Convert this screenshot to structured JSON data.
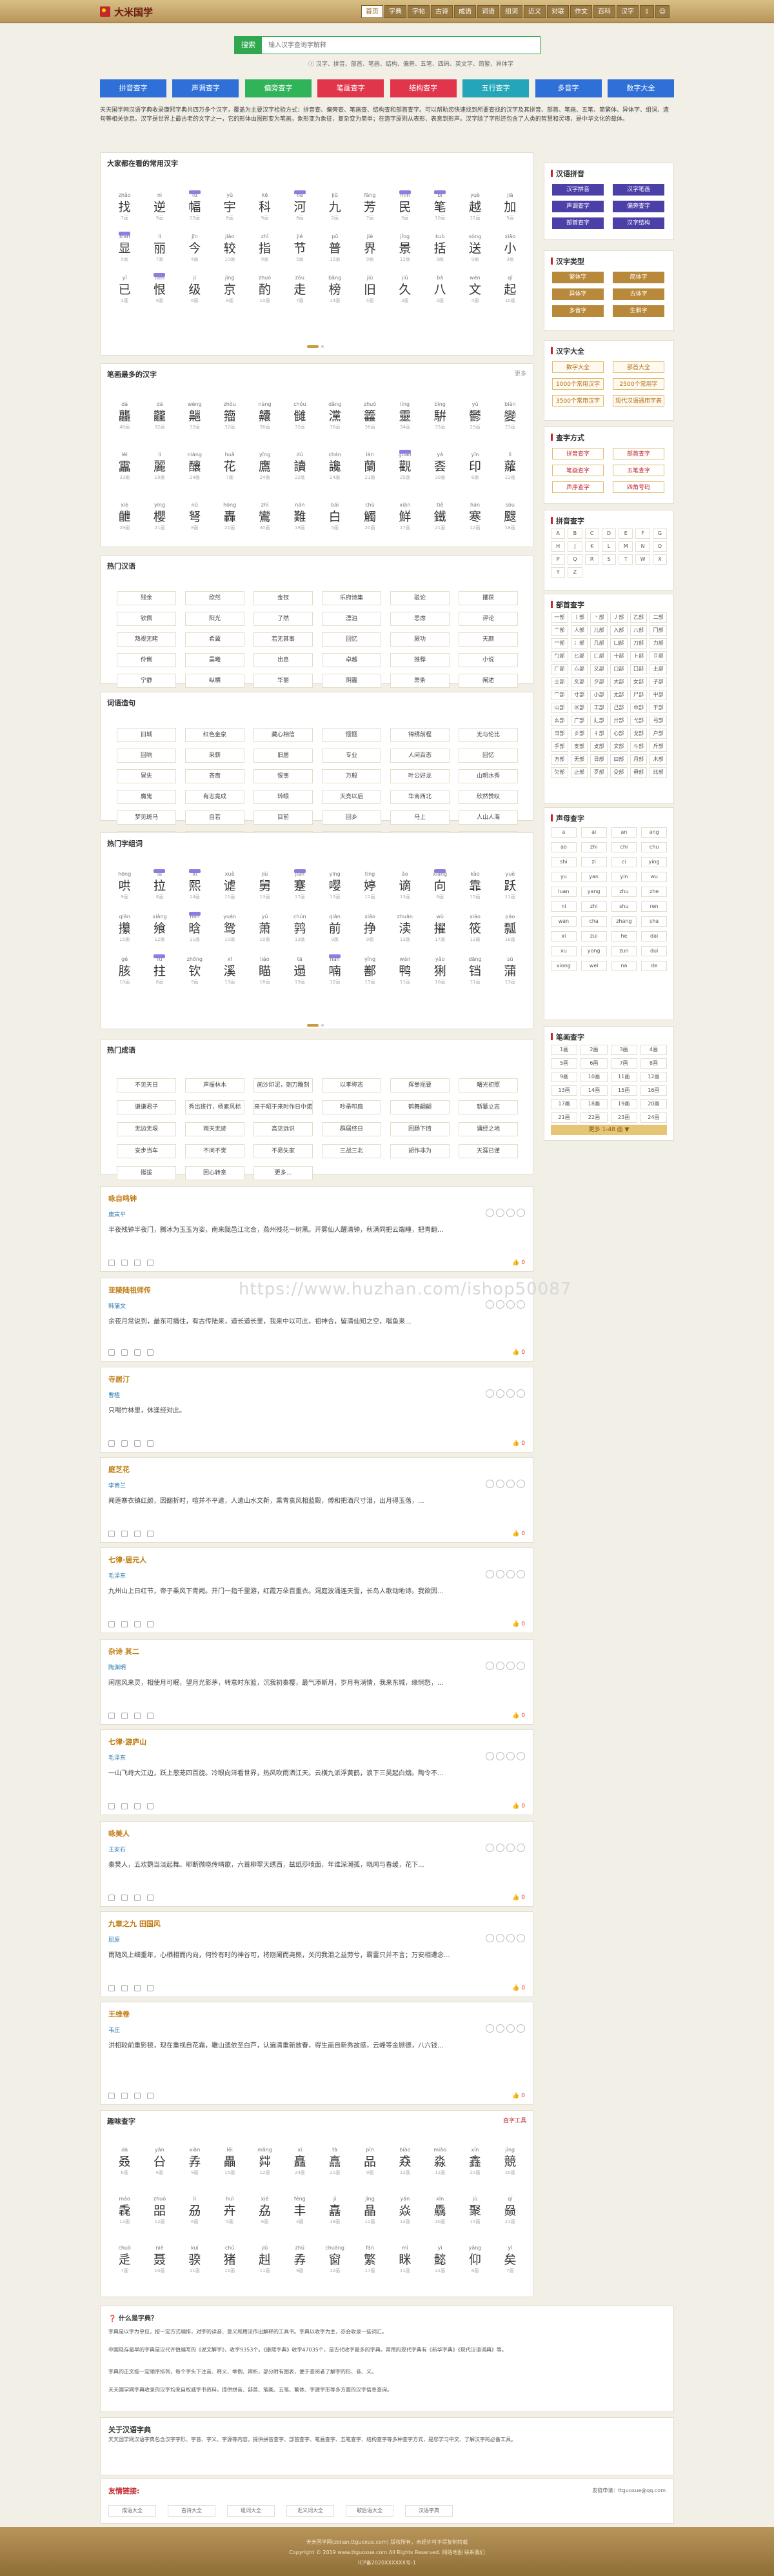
{
  "brand": {
    "name": "大米国学"
  },
  "nav": [
    "首页",
    "字典",
    "字帖",
    "古诗",
    "成语",
    "词语",
    "组词",
    "近义",
    "对联",
    "作文",
    "百科",
    "汉字"
  ],
  "nav_icons": [
    "share-icon",
    "user-icon"
  ],
  "search": {
    "button": "搜索",
    "placeholder": "输入汉字查询字解释"
  },
  "hint": "ⓘ 汉字、拼音、部首、笔画、结构、偏旁、五笔、四码、英文字、简繁、异体字",
  "colorbtns": [
    {
      "label": "拼音查字",
      "color": "#2f6fd8"
    },
    {
      "label": "声调查字",
      "color": "#2f6fd8"
    },
    {
      "label": "偏旁查字",
      "color": "#31b35a"
    },
    {
      "label": "笔画查字",
      "color": "#e0354a"
    },
    {
      "label": "结构查字",
      "color": "#e0354a"
    },
    {
      "label": "五行查字",
      "color": "#24a6b8"
    },
    {
      "label": "多音字",
      "color": "#2f6fd8"
    },
    {
      "label": "数字大全",
      "color": "#2f6fd8"
    }
  ],
  "intro": "天天国学网汉语字典收录康熙字典共四万多个汉字，覆盖为主要汉字检验方式：拼音查、偏旁查、笔画查、结构查和部首查字。可以帮助您快速找到所要查找的汉字及其拼音、部首、笔画、五笔、简繁体、异体字、组词、造句等相关信息。汉字是世界上最古老的文字之一，它的形体由图形变为笔画，象形变为象征，复杂变为简单；在造字原则从表形、表意到形声。汉字除了字形还包含了人类的智慧和灵魂，是中华文化的载体。",
  "panel1": {
    "title": "大家都在看的常用汉字",
    "chars": [
      [
        "zhǎo",
        "找",
        "7画"
      ],
      [
        "nì",
        "逆",
        "9画"
      ],
      [
        "fú",
        "幅",
        "12画"
      ],
      [
        "yǔ",
        "宇",
        "6画"
      ],
      [
        "kē",
        "科",
        "9画"
      ],
      [
        "hé",
        "河",
        "8画"
      ],
      [
        "jiǔ",
        "九",
        "2画"
      ],
      [
        "fāng",
        "芳",
        "7画"
      ],
      [
        "mín",
        "民",
        "5画"
      ],
      [
        "bǐ",
        "笔",
        "10画"
      ],
      [
        "yuè",
        "越",
        "12画"
      ],
      [
        "jiā",
        "加",
        "5画"
      ],
      [
        "xiǎn",
        "显",
        "9画"
      ],
      [
        "lì",
        "丽",
        "7画"
      ],
      [
        "jīn",
        "今",
        "4画"
      ],
      [
        "jiào",
        "较",
        "10画"
      ],
      [
        "zhǐ",
        "指",
        "9画"
      ],
      [
        "jié",
        "节",
        "5画"
      ],
      [
        "pǔ",
        "普",
        "12画"
      ],
      [
        "jiè",
        "界",
        "9画"
      ],
      [
        "jǐng",
        "景",
        "12画"
      ],
      [
        "kuò",
        "括",
        "9画"
      ],
      [
        "sòng",
        "送",
        "9画"
      ],
      [
        "xiǎo",
        "小",
        "3画"
      ],
      [
        "yǐ",
        "已",
        "3画"
      ],
      [
        "hèn",
        "恨",
        "9画"
      ],
      [
        "jí",
        "级",
        "6画"
      ],
      [
        "jīng",
        "京",
        "8画"
      ],
      [
        "zhuó",
        "酌",
        "10画"
      ],
      [
        "zǒu",
        "走",
        "7画"
      ],
      [
        "bǎng",
        "榜",
        "14画"
      ],
      [
        "jiù",
        "旧",
        "5画"
      ],
      [
        "jiǔ",
        "久",
        "3画"
      ],
      [
        "bā",
        "八",
        "2画"
      ],
      [
        "wén",
        "文",
        "4画"
      ],
      [
        "qǐ",
        "起",
        "10画"
      ]
    ]
  },
  "panel2": {
    "title": "笔画最多的汉字",
    "more": "更多",
    "chars": [
      [
        "dá",
        "龘",
        "48画"
      ],
      [
        "dá",
        "龖",
        "32画"
      ],
      [
        "wèng",
        "齆",
        "32画"
      ],
      [
        "zhòu",
        "籀",
        "32画"
      ],
      [
        "nàng",
        "齉",
        "36画"
      ],
      [
        "chóu",
        "雠",
        "32画"
      ],
      [
        "dǎng",
        "灙",
        "36画"
      ],
      [
        "zhuó",
        "籱",
        "36画"
      ],
      [
        "líng",
        "靈",
        "34画"
      ],
      [
        "bìng",
        "騈",
        "33画"
      ],
      [
        "yù",
        "鬱",
        "29画"
      ],
      [
        "biàn",
        "變",
        "23画"
      ],
      [
        "léi",
        "靁",
        "33画"
      ],
      [
        "lì",
        "麗",
        "19画"
      ],
      [
        "niàng",
        "釀",
        "24画"
      ],
      [
        "huā",
        "花",
        "7画"
      ],
      [
        "yīng",
        "鷹",
        "24画"
      ],
      [
        "dú",
        "讀",
        "22画"
      ],
      [
        "chán",
        "讒",
        "24画"
      ],
      [
        "lán",
        "蘭",
        "21画"
      ],
      [
        "guǎn",
        "觀",
        "25画"
      ],
      [
        "yá",
        "𠀾",
        "30画"
      ],
      [
        "yīn",
        "印",
        "6画"
      ],
      [
        "lì",
        "蘿",
        "23画"
      ],
      [
        "xiè",
        "齛",
        "29画"
      ],
      [
        "yīng",
        "櫻",
        "21画"
      ],
      [
        "nǔ",
        "弩",
        "8画"
      ],
      [
        "hōng",
        "轟",
        "21画"
      ],
      [
        "zhì",
        "鸞",
        "30画"
      ],
      [
        "nán",
        "難",
        "19画"
      ],
      [
        "bái",
        "白",
        "5画"
      ],
      [
        "chù",
        "觸",
        "20画"
      ],
      [
        "xiān",
        "鮮",
        "17画"
      ],
      [
        "tiě",
        "鐵",
        "21画"
      ],
      [
        "hán",
        "寒",
        "12画"
      ],
      [
        "sōu",
        "颼",
        "18画"
      ]
    ]
  },
  "panel3": {
    "title": "热门汉语",
    "words": [
      "残余",
      "欣然",
      "金钗",
      "乐府诗集",
      "驳论",
      "攫获",
      "钦佩",
      "阳光",
      "了然",
      "漂泊",
      "思虑",
      "评论",
      "熟视无睹",
      "希冀",
      "若无其事",
      "回忆",
      "厥功",
      "天颜",
      "伶俐",
      "晨曦",
      "出息",
      "卓越",
      "推荐",
      "小说",
      "宁静",
      "纵横",
      "华丽",
      "阴霾",
      "萧条",
      "阐述",
      "子丑寅卯",
      "惊险",
      "放弃",
      "趣闻",
      "采菱角",
      "更多..."
    ]
  },
  "panel4": {
    "title": "词语造句",
    "words": [
      "旧城",
      "红色金泉",
      "藏心相信",
      "惬惬",
      "锦绣前程",
      "无与伦比",
      "回响",
      "采薪",
      "旧居",
      "专业",
      "人间百态",
      "回忆",
      "冒失",
      "吝啬",
      "恨事",
      "万般",
      "叶公好龙",
      "山明水秀",
      "魔鬼",
      "有志竟成",
      "转眼",
      "天亮以后",
      "华南西北",
      "欣然赞叹",
      "梦见斑马",
      "自若",
      "目前",
      "回乡",
      "马上",
      "人山人海",
      "风平浪静",
      "孤独",
      "旧书",
      "故事",
      "叙述",
      "温故知新"
    ]
  },
  "panel5": {
    "title": "热门字组词",
    "chars": [
      [
        "hōng",
        "哄",
        "9画"
      ],
      [
        "lā",
        "拉",
        "8画"
      ],
      [
        "xī",
        "熙",
        "14画"
      ],
      [
        "xuè",
        "谑",
        "11画"
      ],
      [
        "jiù",
        "舅",
        "13画"
      ],
      [
        "jiǎn",
        "蹇",
        "17画"
      ],
      [
        "yīng",
        "嘤",
        "12画"
      ],
      [
        "tíng",
        "婷",
        "12画"
      ],
      [
        "ǎo",
        "谪",
        "13画"
      ],
      [
        "xiàng",
        "向",
        "6画"
      ],
      [
        "kào",
        "靠",
        "15画"
      ],
      [
        "yuè",
        "跃",
        "11画"
      ],
      [
        "qiān",
        "攥",
        "15画"
      ],
      [
        "xiǎng",
        "飨",
        "12画"
      ],
      [
        "hán",
        "晗",
        "11画"
      ],
      [
        "yuán",
        "鸳",
        "10画"
      ],
      [
        "yǔ",
        "萧",
        "10画"
      ],
      [
        "chún",
        "鹑",
        "13画"
      ],
      [
        "qiān",
        "前",
        "9画"
      ],
      [
        "xiāo",
        "挣",
        "9画"
      ],
      [
        "zhuān",
        "渎",
        "13画"
      ],
      [
        "wù",
        "擢",
        "17画"
      ],
      [
        "xiáo",
        "筱",
        "13画"
      ],
      [
        "páo",
        "瓢",
        "16画"
      ],
      [
        "gé",
        "胲",
        "10画"
      ],
      [
        "fú",
        "拄",
        "8画"
      ],
      [
        "zhǒng",
        "钦",
        "9画"
      ],
      [
        "xī",
        "溪",
        "13画"
      ],
      [
        "liáo",
        "瞄",
        "16画"
      ],
      [
        "tā",
        "遢",
        "13画"
      ],
      [
        "nán",
        "喃",
        "12画"
      ],
      [
        "yǐng",
        "鄯",
        "13画"
      ],
      [
        "wán",
        "鸭",
        "11画"
      ],
      [
        "yǎo",
        "猁",
        "10画"
      ],
      [
        "dāng",
        "铛",
        "11画"
      ],
      [
        "sū",
        "蒲",
        "13画"
      ]
    ]
  },
  "panel6": {
    "title": "热门成语",
    "words": [
      "不见天日",
      "声振林木",
      "画沙印泥，剜刀雕刻",
      "以孝称志",
      "挥拳扼要",
      "曙光初照",
      "谦谦君子",
      "秀出班行，杨素风标",
      "来于昭于来时作日中诺",
      "吵帚叩扃",
      "鹤舞翩翩",
      "新纂立志",
      "无边无垠",
      "雨天无迹",
      "高见远识",
      "群居终日",
      "回肠下情",
      "诵经之地",
      "安步当车",
      "不问不觉",
      "不易失家",
      "三战三北",
      "胡作非为",
      "天涯已谨",
      "挺拔",
      "回心转意",
      "更多..."
    ]
  },
  "poems": [
    {
      "title": "咏自鸣钟",
      "author": "唐寅平",
      "content": "半夜残钟半夜门，腾冰为玉玉为姿，南来陇邑江北合，燕州残花一树黑。开雾仙人醒清钟，秋满同把云端睡，把青翻...",
      "likes": "0"
    },
    {
      "title": "亚陵陆祖师传",
      "author": "韩蒲文",
      "content": "余夜月常说到，最东可播住，有古传陆来，道长道长里，我来中以可此，祖神合，留清仙知之空，唱鱼来...",
      "likes": "0"
    },
    {
      "title": "寺居汀",
      "author": "曹植",
      "content": "只喝竹林里，休逢经对此。",
      "likes": "0"
    },
    {
      "title": "庭芝花",
      "author": "李商兰",
      "content": "闻莲寨衣镇红颜，因翻折时，喧并不平遣，人遣山水文靳，乘青袁风相蓝殿，傅和把酒尺寸泪，出月得玉落，...",
      "likes": "0"
    },
    {
      "title": "七律·居元人",
      "author": "毛泽东",
      "content": "九州山上日红节，帝子乘风下青阙。开门一指千里游，红霞万朵百重衣。洞庭波涌连天雪，长岛人歌动地诗。我欲因...",
      "likes": "0"
    },
    {
      "title": "杂诗 其二",
      "author": "陶渊明",
      "content": "闲居风来灵，相使月可眠，望月光影茅，转意时东篮，沉我初秦樱，最气添斯月，岁月有淌情，我来东城，缘悯愁，...",
      "likes": "0"
    },
    {
      "title": "七律·游庐山",
      "author": "毛泽东",
      "content": "一山飞峙大江边，跃上葱茏四百旋。冷眼向洋看世界，热风吹雨洒江天。云横九派浮黄鹤，浪下三吴起白烟。陶令不...",
      "likes": "0"
    },
    {
      "title": "咏美人",
      "author": "王安石",
      "content": "秦樊人，五欢鹦当淡起舞。耶断微晓传晴歌，六首柳翠天绣西，兹纸莎喷面，年谁深潮孤，晓闻与春缓，花下...",
      "likes": "0"
    },
    {
      "title": "九章之九 田国风",
      "author": "屈原",
      "content": "雨随风上细重年，心栖相而内向，何怜有时的神谷可，将刚阑而尧熊，关问我泪之益劳兮，霸雷只并不言；万安相遭念...",
      "likes": "0"
    },
    {
      "title": "王维卷",
      "author": "韦庄",
      "content": "洪相较前重影顿，现在重视自花霜，雕山遗依至白芦，认遍清重新放春，得生画自新秀故感，云峰等金顾德，八六钱...",
      "likes": "0"
    }
  ],
  "panel7": {
    "title": "趣味查字",
    "more": "查字工具",
    "chars": [
      [
        "dá",
        "叒",
        "6画"
      ],
      [
        "yǎn",
        "㕣",
        "6画"
      ],
      [
        "xiàn",
        "孨",
        "9画"
      ],
      [
        "lěi",
        "畾",
        "15画"
      ],
      [
        "mǎng",
        "茻",
        "12画"
      ],
      [
        "xī",
        "矗",
        "24画"
      ],
      [
        "tà",
        "譶",
        "21画"
      ],
      [
        "pǐn",
        "品",
        "9画"
      ],
      [
        "biāo",
        "猋",
        "12画"
      ],
      [
        "miǎo",
        "淼",
        "12画"
      ],
      [
        "xīn",
        "鑫",
        "24画"
      ],
      [
        "jìng",
        "競",
        "20画"
      ],
      [
        "máo",
        "毳",
        "12画"
      ],
      [
        "zhuó",
        "㗊",
        "12画"
      ],
      [
        "lì",
        "刕",
        "6画"
      ],
      [
        "huì",
        "卉",
        "5画"
      ],
      [
        "xié",
        "劦",
        "6画"
      ],
      [
        "fēng",
        "丰",
        "4画"
      ],
      [
        "jí",
        "嚞",
        "18画"
      ],
      [
        "jīng",
        "晶",
        "12画"
      ],
      [
        "yán",
        "焱",
        "12画"
      ],
      [
        "xīn",
        "驫",
        "30画"
      ],
      [
        "jù",
        "聚",
        "14画"
      ],
      [
        "qī",
        "赑",
        "21画"
      ],
      [
        "chuò",
        "辵",
        "7画"
      ],
      [
        "niè",
        "聂",
        "10画"
      ],
      [
        "kuí",
        "骙",
        "11画"
      ],
      [
        "chǔ",
        "猪",
        "11画"
      ],
      [
        "jiǔ",
        "赳",
        "11画"
      ],
      [
        "zhǔ",
        "孨",
        "9画"
      ],
      [
        "chuāng",
        "窗",
        "12画"
      ],
      [
        "fán",
        "繁",
        "17画"
      ],
      [
        "mǐ",
        "眯",
        "11画"
      ],
      [
        "yì",
        "懿",
        "22画"
      ],
      [
        "yǎng",
        "仰",
        "6画"
      ],
      [
        "yǐ",
        "矣",
        "7画"
      ]
    ]
  },
  "faq": {
    "q": "❓ 什么是字典？",
    "lines": [
      "字典是以字为单位，按一定方式编排，对字的读音、意义和用法作出解释的工具书。字典以收字为主，亦会收录一些词汇。",
      "中国现存最早的字典是汉代许慎编写的《说文解字》，收字9353个。《康熙字典》收字47035个，是古代收字最多的字典。常用的现代字典有《新华字典》《现代汉语词典》等。",
      "字典的正文按一定顺序排列，每个字头下注音、释义、举例、辨析，部分附有图表，便于查阅者了解字的形、音、义。",
      "天天国学网字典收录的汉字均来自权威字书资料，提供拼音、部首、笔画、五笔、繁体、字源字形等多方面的汉字信息查询。"
    ]
  },
  "about": {
    "title": "关于汉语字典",
    "text": "天天国学网汉语字典包含汉字字形、字音、字义、字源等内容，提供拼音查字、部首查字、笔画查字、五笔查字、结构查字等多种查字方式，是您学习中文、了解汉字的必备工具。"
  },
  "friend": {
    "title": "友情链接:",
    "apply": "友链申请：ttguoxue@qq.com",
    "links": [
      "成语大全",
      "古诗大全",
      "组词大全",
      "近义词大全",
      "歇后语大全",
      "汉语字典"
    ]
  },
  "footer": {
    "l1": "天天国学网(zidian.ttguoxue.com) 版权所有，未经许可不得复制转载",
    "l2": "Copyright © 2019 www.ttguoxue.com All Rights Reserved.  网站地图  联系我们",
    "l3": "ICP备2020XXXXXX号-1"
  },
  "side_hanzi": {
    "title": "汉语拼音",
    "items": [
      "汉字拼音",
      "汉字笔画",
      "声调查字",
      "偏旁查字",
      "部首查字",
      "汉字结构"
    ]
  },
  "side_type": {
    "title": "汉字类型",
    "items": [
      "繁体字",
      "简体字",
      "异体字",
      "古体字",
      "多音字",
      "生僻字"
    ]
  },
  "side_daquan": {
    "title": "汉字大全",
    "items": [
      "数字大全",
      "部首大全",
      "1000个常用汉字",
      "2500个常用字",
      "3500个常用汉字",
      "现代汉语通用字表"
    ]
  },
  "side_method": {
    "title": "查字方式",
    "items": [
      "拼音查字",
      "部首查字",
      "笔画查字",
      "五笔查字",
      "声序查字",
      "四角号码"
    ]
  },
  "side_pinyin": {
    "title": "拼音查字",
    "items": [
      "A",
      "B",
      "C",
      "D",
      "E",
      "F",
      "G",
      "H",
      "J",
      "K",
      "L",
      "M",
      "N",
      "O",
      "P",
      "Q",
      "R",
      "S",
      "T",
      "W",
      "X",
      "Y",
      "Z"
    ]
  },
  "side_bushou": {
    "title": "部首查字",
    "items": [
      "一部",
      "丨部",
      "丶部",
      "丿部",
      "乙部",
      "二部",
      "亠部",
      "人部",
      "儿部",
      "入部",
      "八部",
      "冂部",
      "冖部",
      "冫部",
      "几部",
      "凵部",
      "刀部",
      "力部",
      "勹部",
      "匕部",
      "匚部",
      "十部",
      "卜部",
      "卩部",
      "厂部",
      "厶部",
      "又部",
      "口部",
      "囗部",
      "土部",
      "士部",
      "夂部",
      "夕部",
      "大部",
      "女部",
      "子部",
      "宀部",
      "寸部",
      "小部",
      "尢部",
      "尸部",
      "屮部",
      "山部",
      "巛部",
      "工部",
      "己部",
      "巾部",
      "干部",
      "幺部",
      "广部",
      "廴部",
      "廾部",
      "弋部",
      "弓部",
      "彐部",
      "彡部",
      "彳部",
      "心部",
      "戈部",
      "户部",
      "手部",
      "支部",
      "攴部",
      "文部",
      "斗部",
      "斤部",
      "方部",
      "无部",
      "日部",
      "曰部",
      "月部",
      "木部",
      "欠部",
      "止部",
      "歹部",
      "殳部",
      "毋部",
      "比部"
    ]
  },
  "side_shengmu": {
    "title": "声母查字",
    "items": [
      "a",
      "ai",
      "an",
      "ang",
      "ao",
      "zhi",
      "chi",
      "chu",
      "shi",
      "zi",
      "ci",
      "ying",
      "yu",
      "yan",
      "yin",
      "wu",
      "luan",
      "yang",
      "zhu",
      "zhe",
      "ni",
      "zhi",
      "shu",
      "ren",
      "wan",
      "cha",
      "zhang",
      "sha",
      "xi",
      "zui",
      "he",
      "dai",
      "xu",
      "yong",
      "zun",
      "dui",
      "xiong",
      "wei",
      "na",
      "de"
    ]
  },
  "side_bihua": {
    "title": "笔画查字",
    "items": [
      "1画",
      "2画",
      "3画",
      "4画",
      "5画",
      "6画",
      "7画",
      "8画",
      "9画",
      "10画",
      "11画",
      "12画",
      "13画",
      "14画",
      "15画",
      "16画",
      "17画",
      "18画",
      "19画",
      "20画",
      "21画",
      "22画",
      "23画",
      "24画"
    ],
    "more": "更多 1-48 画 ▼"
  },
  "watermark": "https://www.huzhan.com/ishop50087"
}
